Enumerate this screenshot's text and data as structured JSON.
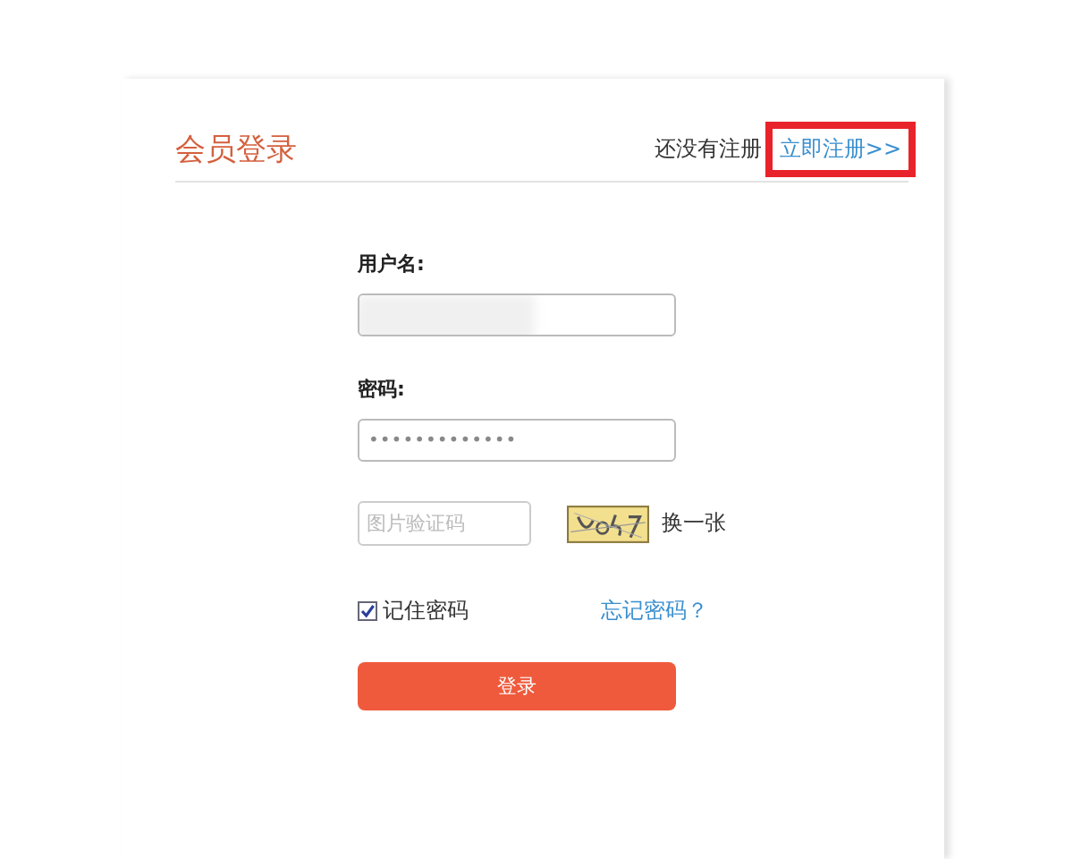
{
  "header": {
    "title": "会员登录",
    "prompt": "还没有注册",
    "register_link": "立即注册>>",
    "register_highlighted": true
  },
  "username": {
    "label": "用户名:",
    "redacted": true
  },
  "password": {
    "label": "密码:",
    "value": "•••••••••••••"
  },
  "captcha": {
    "placeholder": "图片验证码",
    "refresh": "换一张"
  },
  "remember": {
    "label": "记住密码",
    "checked": true
  },
  "forgot_link": "忘记密码？",
  "submit": "登录"
}
